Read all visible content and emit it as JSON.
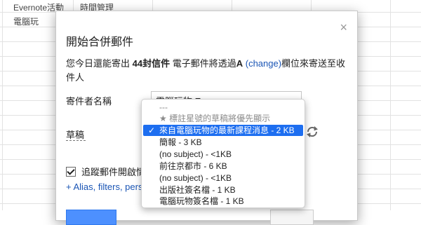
{
  "sheet": {
    "cells": [
      "Evernote活動",
      "時間管理",
      "電腦玩"
    ]
  },
  "dialog": {
    "title": "開始合併郵件",
    "close_glyph": "×",
    "info_part1": "您今日還能寄出 ",
    "info_count": "44封信件",
    "info_part2": " 電子郵件將透過",
    "info_column": "A",
    "info_change": "(change)",
    "info_part3": "欄位來寄送至收件人",
    "sender_label": "寄件者名稱",
    "sender_value": "電腦玩物 Esor",
    "draft_label": "草稿",
    "track_label": "追蹤郵件開啟情形",
    "alias_link": "+ Alias, filters, perso"
  },
  "draft_menu": {
    "options": [
      {
        "label": "---",
        "state": "disabled"
      },
      {
        "label": "★ 標註星號的草稿將優先顯示",
        "state": "disabled"
      },
      {
        "label": "來自電腦玩物的最新課程消息 - 2 KB",
        "state": "selected"
      },
      {
        "label": "簡報 - 3 KB",
        "state": "normal"
      },
      {
        "label": "(no subject) - <1KB",
        "state": "normal"
      },
      {
        "label": "前往京都市 - 6 KB",
        "state": "normal"
      },
      {
        "label": "(no subject) - <1KB",
        "state": "normal"
      },
      {
        "label": "出版社簽名檔 - 1 KB",
        "state": "normal"
      },
      {
        "label": "電腦玩物簽名檔 - 1 KB",
        "state": "normal"
      }
    ],
    "checkmark": "✓"
  },
  "colors": {
    "accent": "#1d6ef0",
    "link": "#1a55b5",
    "primary_button": "#4d90fe"
  },
  "icons": {
    "refresh": "refresh-icon",
    "close": "close-icon",
    "checkbox": "checkbox-checked-icon"
  }
}
